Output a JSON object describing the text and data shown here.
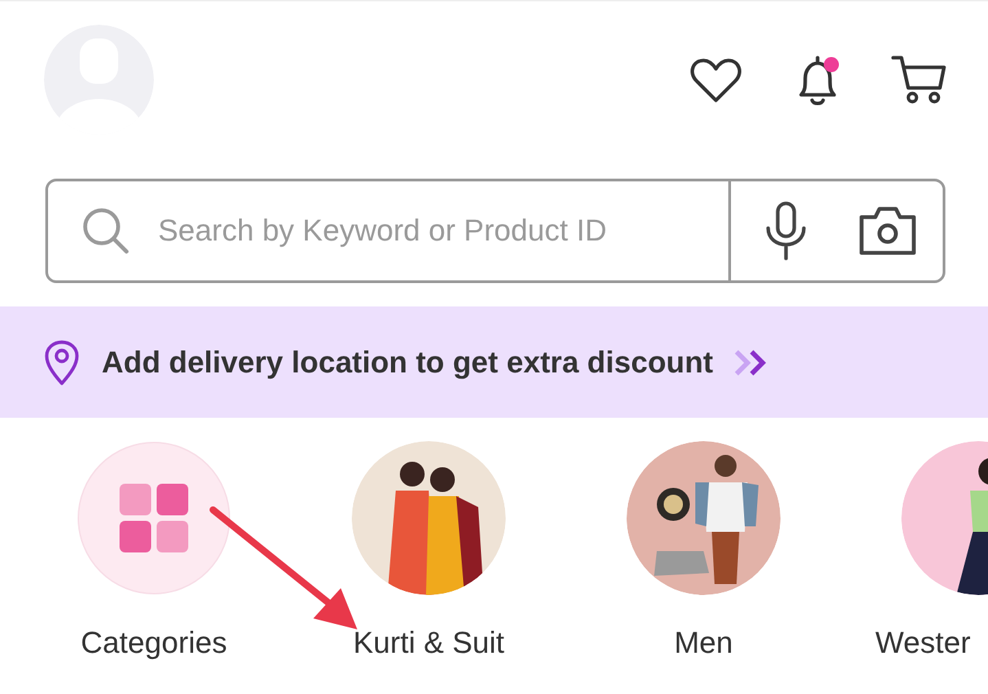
{
  "header": {
    "notification_dot": true
  },
  "search": {
    "placeholder": "Search by Keyword or Product ID"
  },
  "banner": {
    "text": "Add delivery location to get extra discount"
  },
  "categories": [
    {
      "kind": "icon",
      "label": "Categories"
    },
    {
      "kind": "picture",
      "label": "Kurti & Suit"
    },
    {
      "kind": "picture",
      "label": "Men"
    },
    {
      "kind": "picture",
      "label": "Wester"
    }
  ]
}
